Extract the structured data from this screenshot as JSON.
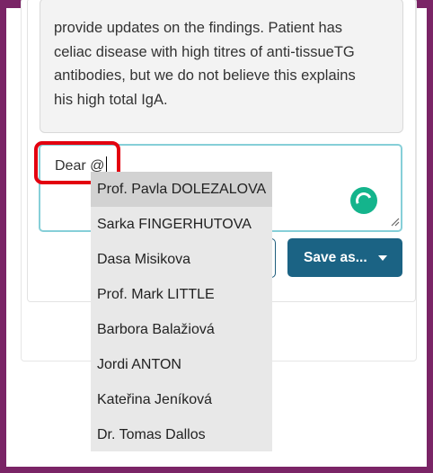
{
  "note": {
    "lines": [
      "provide updates on the findings. Patient has",
      "celiac disease with high titres of anti-tissueTG",
      "antibodies, but we do not believe this explains",
      "his high total IgA."
    ]
  },
  "reply": {
    "value": "Dear @"
  },
  "actions": {
    "save_label": "Save as..."
  },
  "mention_suggestions": [
    "Prof. Pavla DOLEZALOVA",
    "Sarka FINGERHUTOVA",
    "Dasa Misikova",
    "Prof. Mark LITTLE",
    "Barbora Balažiová",
    "Jordi ANTON",
    "Kateřina Jeníková",
    "Dr. Tomas Dallos"
  ],
  "icons": {
    "spinner": "loading-spinner-icon",
    "resize": "resize-handle-icon",
    "dropdown": "caret-down-icon"
  },
  "colors": {
    "frame": "#7a2466",
    "primary_button": "#1b6384",
    "input_focus_border": "#86cfd8",
    "highlight": "#e3000f",
    "spinner": "#14b48c"
  }
}
